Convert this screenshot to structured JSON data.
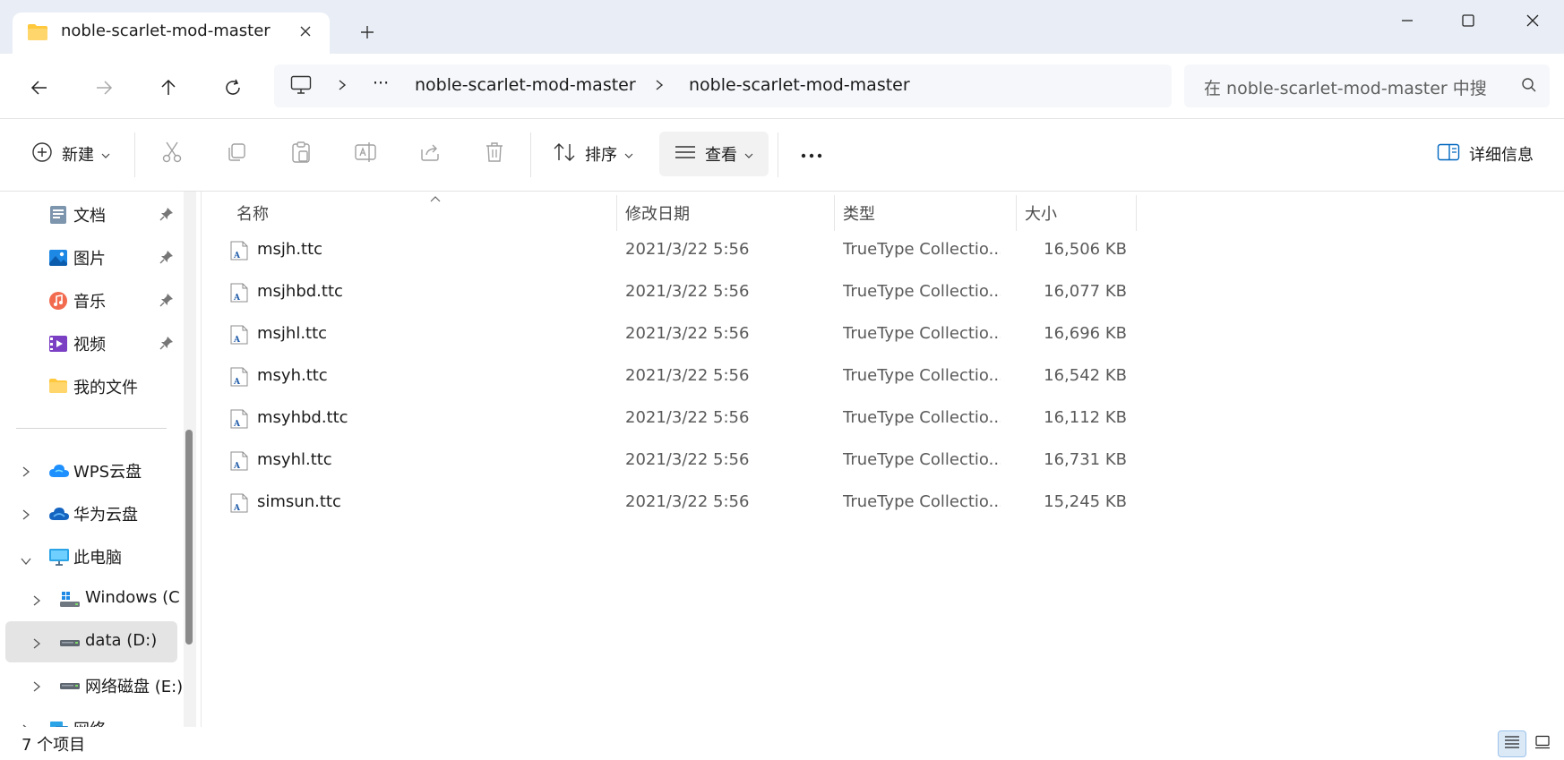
{
  "tab": {
    "title": "noble-scarlet-mod-master"
  },
  "address": {
    "overflow": "···",
    "crumbs": [
      "noble-scarlet-mod-master",
      "noble-scarlet-mod-master"
    ]
  },
  "search": {
    "placeholder": "在 noble-scarlet-mod-master 中搜"
  },
  "commands": {
    "new": "新建",
    "sort": "排序",
    "view": "查看",
    "more": "···",
    "details": "详细信息"
  },
  "sidebar": {
    "items": [
      {
        "label": "文档",
        "icon": "document-icon",
        "pinned": true
      },
      {
        "label": "图片",
        "icon": "pictures-icon",
        "pinned": true
      },
      {
        "label": "音乐",
        "icon": "music-icon",
        "pinned": true
      },
      {
        "label": "视频",
        "icon": "video-icon",
        "pinned": true
      },
      {
        "label": "我的文件",
        "icon": "folder-icon",
        "pinned": false
      },
      {
        "label": "WPS云盘",
        "icon": "wps-cloud-icon"
      },
      {
        "label": "华为云盘",
        "icon": "huawei-cloud-icon"
      },
      {
        "label": "此电脑",
        "icon": "computer-icon"
      },
      {
        "label": "Windows (C",
        "icon": "windows-drive-icon"
      },
      {
        "label": "data (D:)",
        "icon": "drive-icon"
      },
      {
        "label": "网络磁盘 (E:)",
        "icon": "drive-icon"
      },
      {
        "label": "网络",
        "icon": "network-icon"
      }
    ]
  },
  "columns": {
    "name": "名称",
    "date": "修改日期",
    "type": "类型",
    "size": "大小"
  },
  "files": [
    {
      "name": "msjh.ttc",
      "date": "2021/3/22 5:56",
      "type": "TrueType Collectio...",
      "size": "16,506 KB"
    },
    {
      "name": "msjhbd.ttc",
      "date": "2021/3/22 5:56",
      "type": "TrueType Collectio...",
      "size": "16,077 KB"
    },
    {
      "name": "msjhl.ttc",
      "date": "2021/3/22 5:56",
      "type": "TrueType Collectio...",
      "size": "16,696 KB"
    },
    {
      "name": "msyh.ttc",
      "date": "2021/3/22 5:56",
      "type": "TrueType Collectio...",
      "size": "16,542 KB"
    },
    {
      "name": "msyhbd.ttc",
      "date": "2021/3/22 5:56",
      "type": "TrueType Collectio...",
      "size": "16,112 KB"
    },
    {
      "name": "msyhl.ttc",
      "date": "2021/3/22 5:56",
      "type": "TrueType Collectio...",
      "size": "16,731 KB"
    },
    {
      "name": "simsun.ttc",
      "date": "2021/3/22 5:56",
      "type": "TrueType Collectio...",
      "size": "15,245 KB"
    }
  ],
  "status": {
    "count": "7 个项目"
  },
  "colors": {
    "accent": "#0067c0",
    "folder": "#ffc83d",
    "selected": "#e4e4e4"
  }
}
